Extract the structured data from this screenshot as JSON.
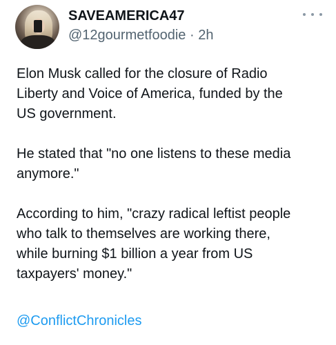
{
  "post": {
    "author_name": "SAVEAMERICA47",
    "handle": "@12gourmetfoodie",
    "separator": "·",
    "time": "2h",
    "more_icon": "more-horizontal-icon",
    "paragraphs": [
      "Elon Musk called for the closure of Radio\nLiberty and Voice of America, funded by the\nUS government.",
      "He stated that \"no one listens to these media\nanymore.\"",
      "According to him, \"crazy radical leftist people\nwho talk to themselves are working there,\nwhile burning $1 billion a year from US\ntaxpayers' money.\""
    ],
    "mention": "@ConflictChronicles"
  },
  "colors": {
    "text": "#0f1419",
    "secondary": "#536471",
    "link": "#1d9bf0",
    "background": "#ffffff"
  }
}
